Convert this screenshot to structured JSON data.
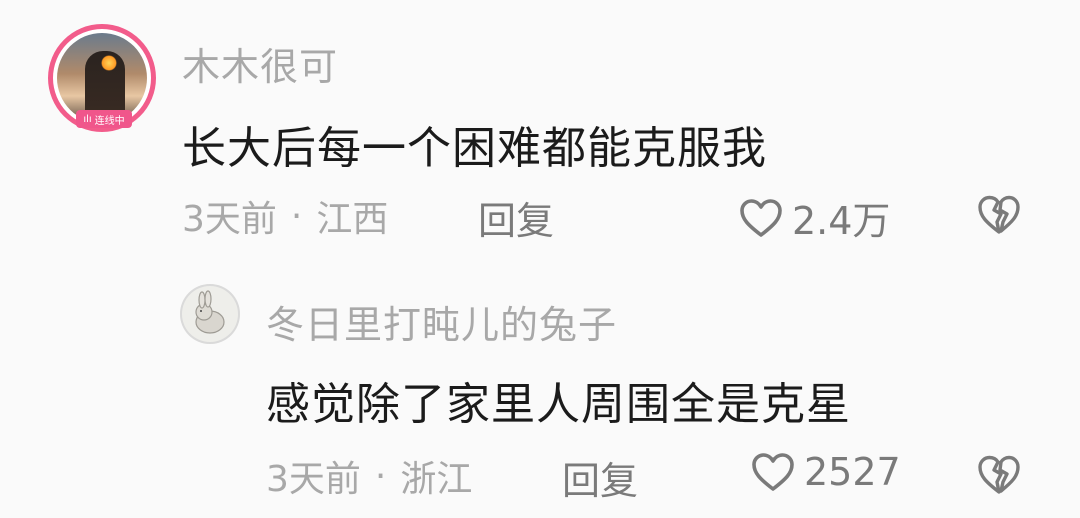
{
  "comments": [
    {
      "username": "木木很可",
      "text": "长大后每一个困难都能克服我",
      "time": "3天前",
      "dot": "·",
      "location": "江西",
      "reply_label": "回复",
      "likes": "2.4万",
      "badge": "连线中"
    },
    {
      "username": "冬日里打盹儿的兔子",
      "text": "感觉除了家里人周围全是克星",
      "time": "3天前",
      "dot": "·",
      "location": "浙江",
      "reply_label": "回复",
      "likes": "2527"
    }
  ],
  "colors": {
    "badge": "#f0568b",
    "meta": "#a8a8a8",
    "text": "#1b1b1b"
  }
}
